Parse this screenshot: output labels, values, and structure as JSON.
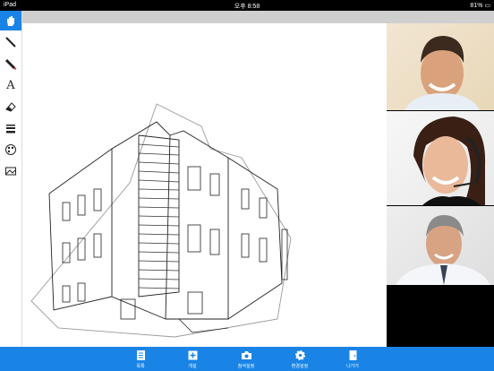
{
  "status_bar": {
    "device": "iPad",
    "time": "오후 8:58",
    "battery": "81%"
  },
  "toolbar": {
    "tools": [
      {
        "icon": "hand-icon",
        "active": true
      },
      {
        "icon": "pen-icon"
      },
      {
        "icon": "highlighter-icon"
      },
      {
        "icon": "text-icon",
        "glyph": "A"
      },
      {
        "icon": "eraser-icon"
      },
      {
        "icon": "line-width-icon"
      },
      {
        "icon": "palette-icon"
      },
      {
        "icon": "image-icon"
      }
    ]
  },
  "bottom_bar": {
    "buttons": [
      {
        "label": "목록",
        "icon": "list-icon"
      },
      {
        "label": "개설",
        "icon": "plus-icon"
      },
      {
        "label": "참석설정",
        "icon": "camera-icon"
      },
      {
        "label": "환경설정",
        "icon": "gear-icon"
      },
      {
        "label": "나가기",
        "icon": "exit-icon"
      }
    ]
  },
  "colors": {
    "accent": "#1a84e6",
    "topbar": "#cfcfcf"
  }
}
